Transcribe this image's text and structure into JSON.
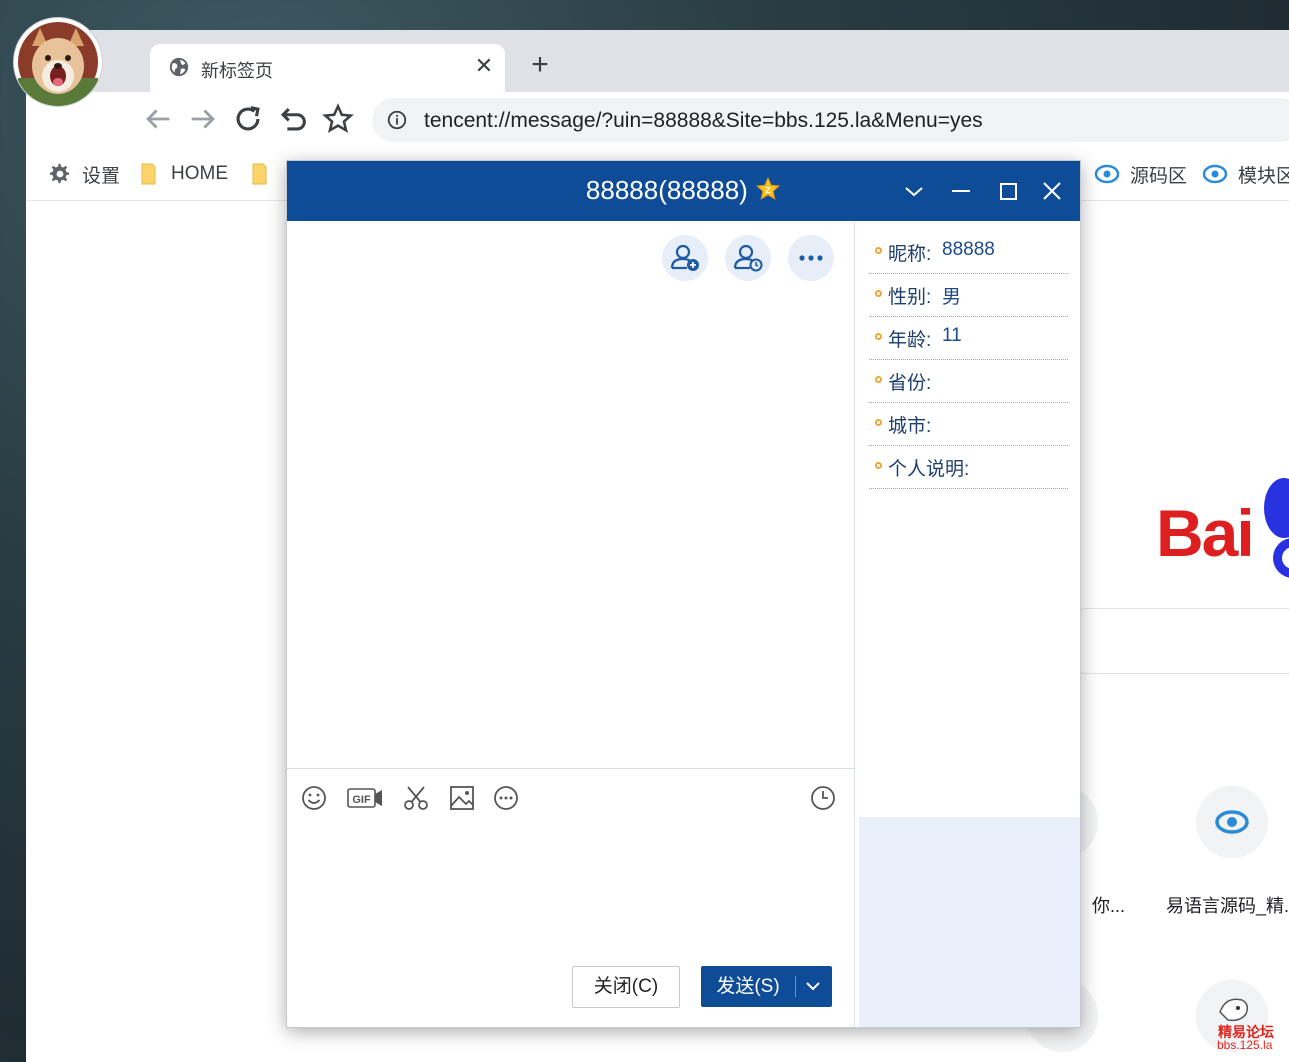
{
  "browser": {
    "tab_title": "新标签页",
    "tab_close": "✕",
    "new_tab": "+",
    "address": "tencent://message/?uin=88888&Site=bbs.125.la&Menu=yes",
    "bookmarks": {
      "settings": "设置",
      "home": "HOME",
      "source": "源码区",
      "module": "模块区"
    }
  },
  "background_page": {
    "logo_text": "Bai",
    "shortcut_1": "你...",
    "shortcut_2": "易语言源码_精..."
  },
  "qq_dialog": {
    "title": "88888(88888)",
    "profile": {
      "nickname_label": "昵称:",
      "nickname": "88888",
      "gender_label": "性别:",
      "gender": "男",
      "age_label": "年龄:",
      "age": "11",
      "province_label": "省份:",
      "province": "",
      "city_label": "城市:",
      "city": "",
      "bio_label": "个人说明:",
      "bio": ""
    },
    "close_button": "关闭(C)",
    "send_button": "发送(S)",
    "toolbar_gif": "GIF"
  },
  "watermark": {
    "line1": "精易论坛",
    "line2": "bbs.125.la"
  },
  "colors": {
    "qq_blue": "#0f4c97",
    "profile_text": "#1d3f6d",
    "baidu_red": "#de1f1f",
    "baidu_blue": "#2932e1"
  }
}
